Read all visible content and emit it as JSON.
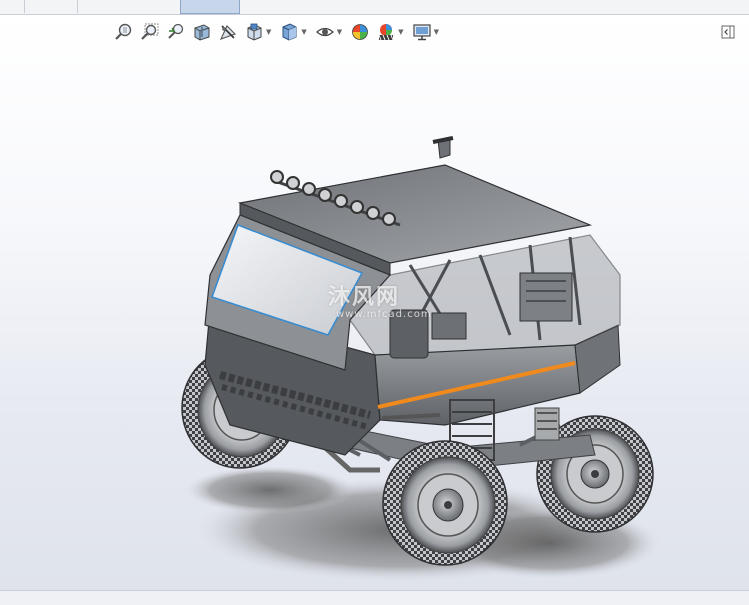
{
  "toolbar": {
    "icons": [
      "zoom-to-fit-icon",
      "zoom-to-area-icon",
      "previous-view-icon",
      "section-view-icon",
      "dynamic-annotation-icon",
      "view-orientation-icon",
      "display-style-icon",
      "hide-show-items-icon",
      "edit-appearance-icon",
      "apply-scene-icon",
      "view-settings-icon"
    ]
  },
  "model": {
    "subject": "off-road expedition vehicle",
    "accent_color": "#f08a1c",
    "body_color": "#8f9296"
  },
  "watermark": {
    "main": "沐风网",
    "sub": "www.mfcad.com"
  },
  "colors": {
    "active_tab": "#c7d6ea",
    "viewport_bottom": "#dfe3ec"
  }
}
